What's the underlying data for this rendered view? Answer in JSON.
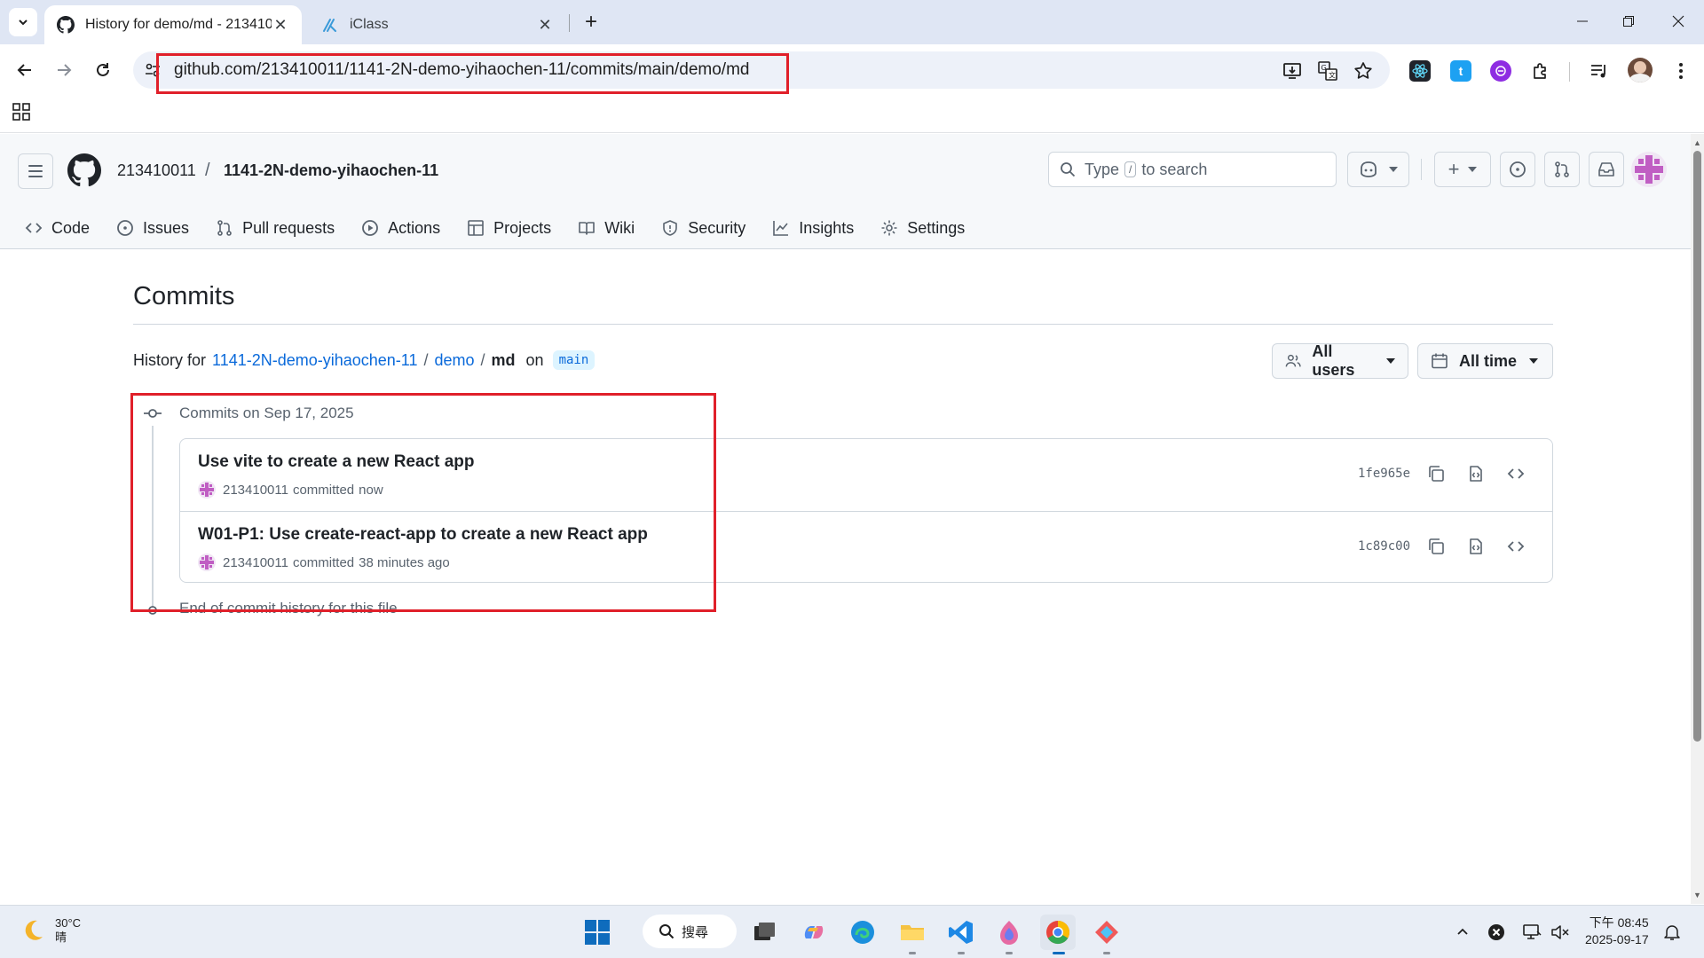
{
  "browser": {
    "tabs": [
      {
        "title": "History for demo/md - 213410011",
        "active": true
      },
      {
        "title": "iClass",
        "active": false
      }
    ],
    "url": "github.com/213410011/1141-2N-demo-yihaochen-11/commits/main/demo/md"
  },
  "header": {
    "owner": "213410011",
    "separator": "/",
    "repo": "1141-2N-demo-yihaochen-11",
    "search_prefix": "Type",
    "search_key": "/",
    "search_suffix": "to search"
  },
  "repo_nav": [
    "Code",
    "Issues",
    "Pull requests",
    "Actions",
    "Projects",
    "Wiki",
    "Security",
    "Insights",
    "Settings"
  ],
  "page": {
    "title": "Commits",
    "history_prefix": "History for",
    "crumb_repo": "1141-2N-demo-yihaochen-11",
    "crumb_dir": "demo",
    "crumb_file": "md",
    "on_word": "on",
    "branch": "main",
    "filter_users": "All users",
    "filter_time": "All time",
    "group_label": "Commits on Sep 17, 2025",
    "end_label": "End of commit history for this file"
  },
  "commits": [
    {
      "message": "Use vite to create a new React app",
      "author": "213410011",
      "action": "committed",
      "when": "now",
      "sha": "1fe965e"
    },
    {
      "message": "W01-P1: Use create-react-app to create a new React app",
      "author": "213410011",
      "action": "committed",
      "when": "38 minutes ago",
      "sha": "1c89c00"
    }
  ],
  "taskbar": {
    "temperature": "30°C",
    "condition": "晴",
    "search_label": "搜尋",
    "time": "下午 08:45",
    "date": "2025-09-17"
  },
  "colors": {
    "link": "#0969da",
    "highlight": "#e0202a",
    "muted": "#59636e"
  }
}
